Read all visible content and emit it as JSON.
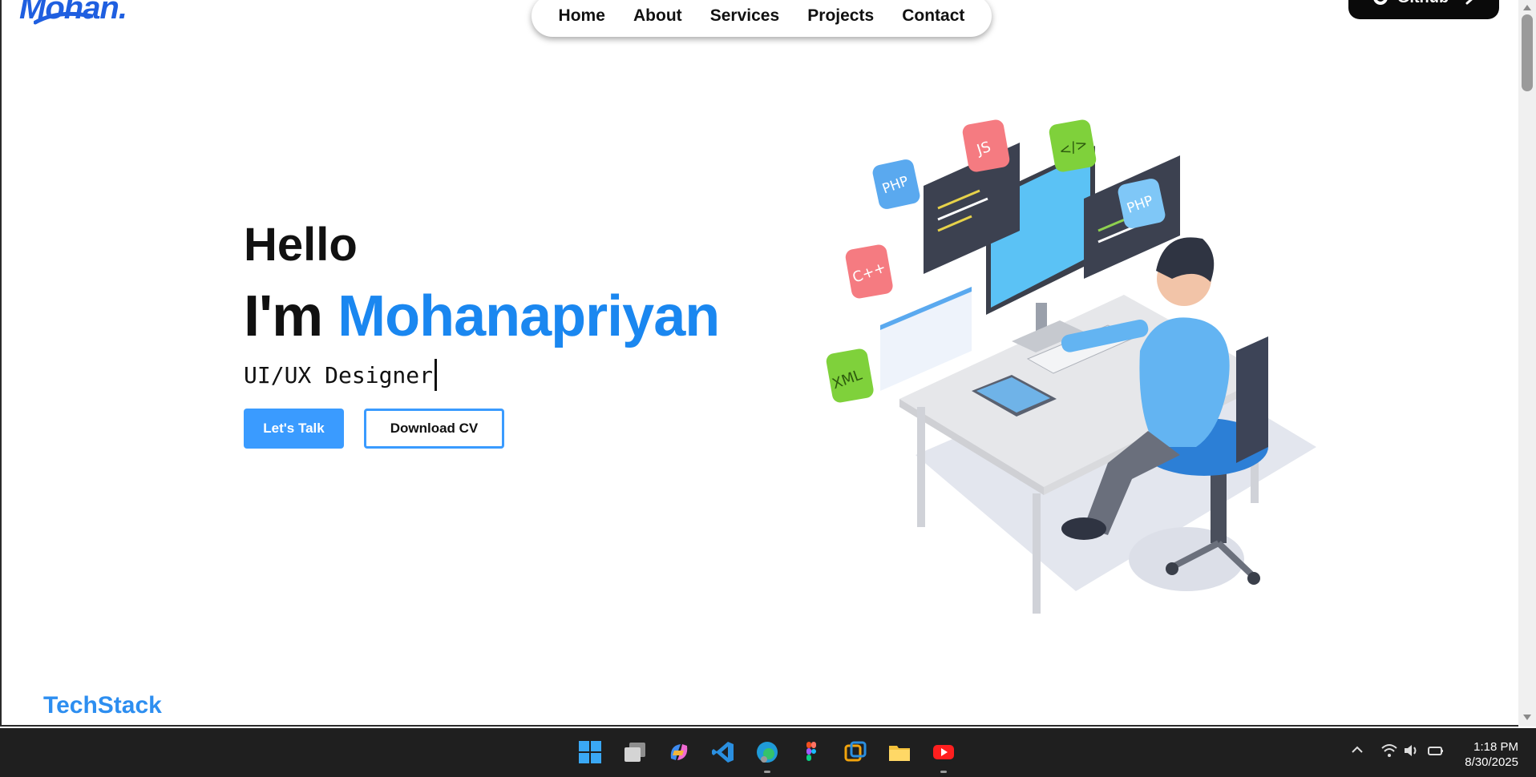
{
  "header": {
    "logo_text": "Mohan.",
    "nav": [
      "Home",
      "About",
      "Services",
      "Projects",
      "Contact"
    ],
    "github_label": "Github"
  },
  "hero": {
    "greeting": "Hello",
    "intro_prefix": "I'm",
    "name": "Mohanapriyan",
    "role": "UI/UX Designer",
    "primary_cta": "Let's Talk",
    "secondary_cta": "Download CV"
  },
  "illustration": {
    "badges": [
      "PHP",
      "JS",
      "</>",
      "PHP",
      "C++",
      "XML"
    ]
  },
  "section": {
    "techstack_title": "TechStack"
  },
  "taskbar": {
    "apps": [
      "windows-start-icon",
      "task-view-icon",
      "copilot-icon",
      "vscode-icon",
      "edge-icon",
      "figma-icon",
      "app-icon",
      "file-explorer-icon",
      "youtube-icon"
    ],
    "time": "1:18 PM",
    "date": "8/30/2025"
  },
  "colors": {
    "accent": "#1a87f0",
    "button": "#3a9bff",
    "logo": "#1f5fe0",
    "techstack": "#2d8ef0",
    "taskbar": "#1f1f1f"
  }
}
